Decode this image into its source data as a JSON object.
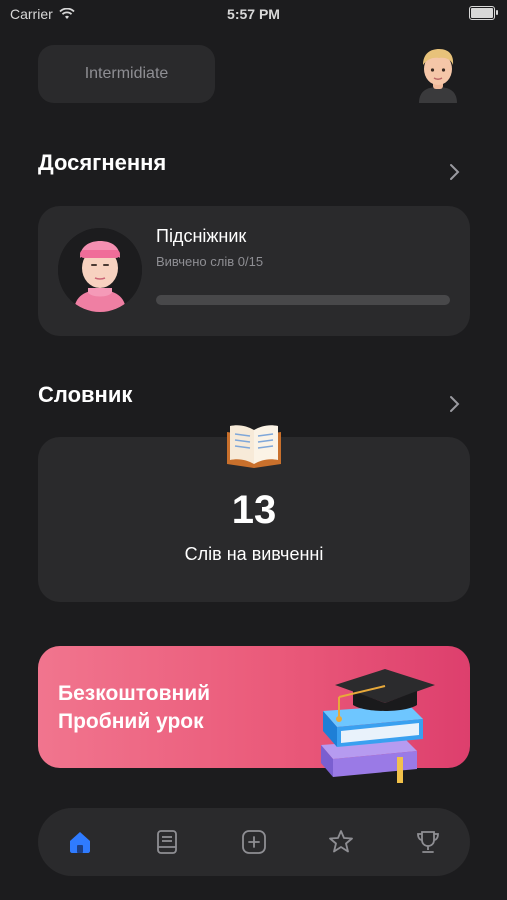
{
  "status_bar": {
    "carrier": "Carrier",
    "time": "5:57 PM"
  },
  "header": {
    "level": "Intermidiate",
    "avatar_icon": "user-avatar-icon"
  },
  "achievements": {
    "title": "Досягнення",
    "item": {
      "name": "Підсніжник",
      "progress_text": "Вивчено слів 0/15",
      "progress_fraction": 0
    }
  },
  "dictionary": {
    "title": "Словник",
    "count": "13",
    "label": "Слів на вивченні"
  },
  "promo": {
    "line1": "Безкоштовний",
    "line2": "Пробний урок"
  },
  "tabs": [
    {
      "icon": "home-icon",
      "active": true
    },
    {
      "icon": "book-list-icon",
      "active": false
    },
    {
      "icon": "add-square-icon",
      "active": false
    },
    {
      "icon": "star-badge-icon",
      "active": false
    },
    {
      "icon": "trophy-icon",
      "active": false
    }
  ],
  "colors": {
    "background": "#1c1c1e",
    "card": "#2a2a2c",
    "accent": "#2f7bff",
    "promo_start": "#f1758e",
    "promo_end": "#dd3f6d"
  }
}
